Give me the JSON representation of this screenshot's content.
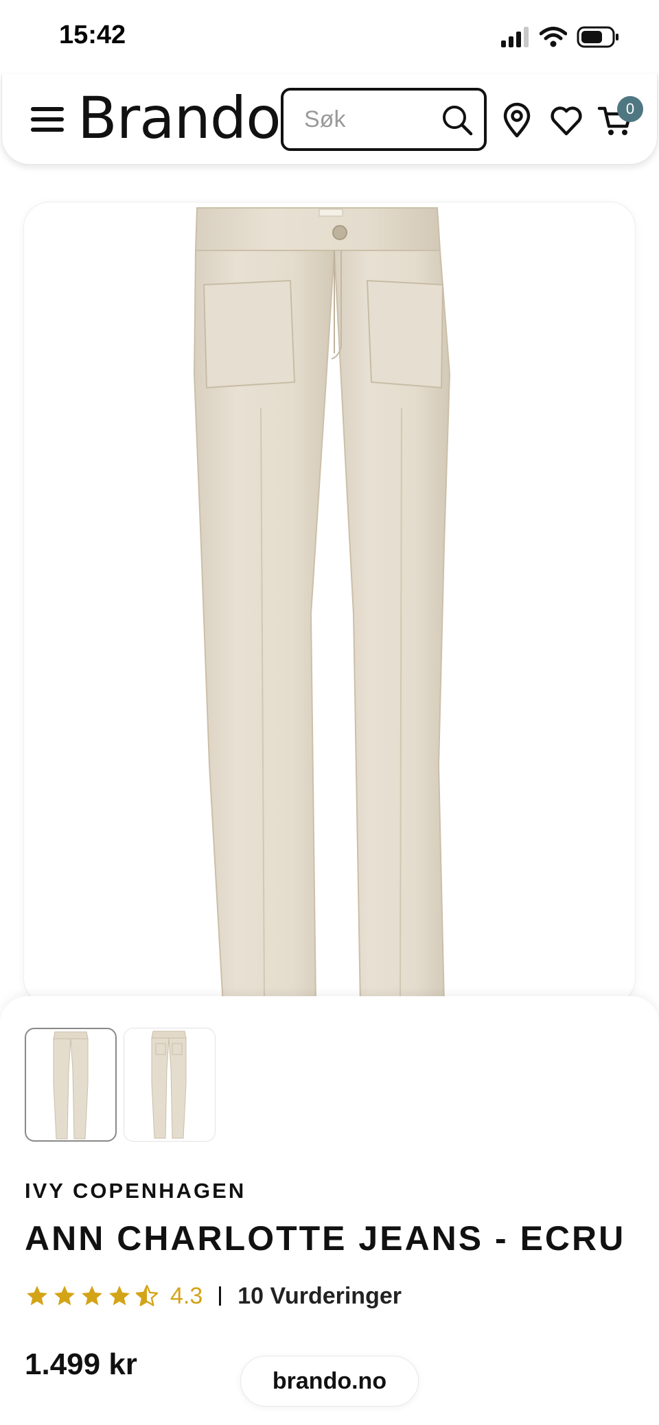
{
  "status_bar": {
    "time": "15:42",
    "icons": [
      "cellular-signal-icon",
      "wifi-icon",
      "battery-icon"
    ]
  },
  "header": {
    "logo": "Brando",
    "search": {
      "placeholder": "Søk",
      "value": ""
    },
    "icons": [
      "menu-icon",
      "search-icon",
      "location-icon",
      "heart-icon",
      "cart-icon"
    ],
    "cart_count": "0",
    "badge_color": "#4f7782"
  },
  "product": {
    "image_alt": "beige flared jeans, front view",
    "thumbnails": [
      {
        "label": "front view",
        "active": true
      },
      {
        "label": "back view",
        "active": false
      }
    ],
    "brand": "IVY COPENHAGEN",
    "name": "ANN CHARLOTTE JEANS - ECRU",
    "rating": {
      "value": "4.3",
      "stars_filled": 4.5,
      "stars_max": 5,
      "color": "#d4a418"
    },
    "reviews_label": "10 Vurderinger",
    "price": "1.499 kr"
  },
  "browser": {
    "url": "brando.no"
  }
}
